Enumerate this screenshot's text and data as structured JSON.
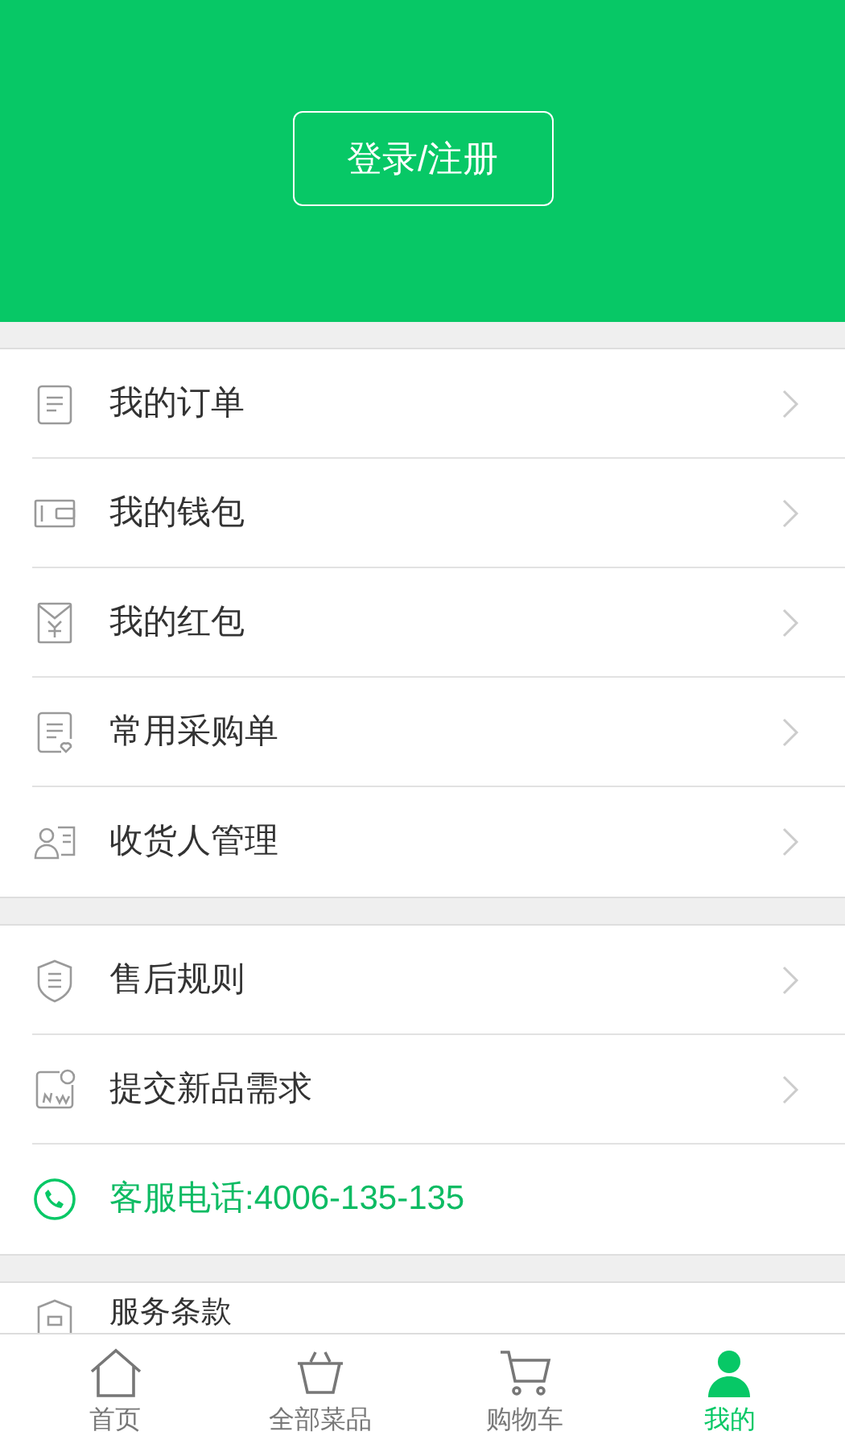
{
  "header": {
    "login_button": "登录/注册"
  },
  "sections": [
    {
      "items": [
        {
          "kind": "link",
          "label": "我的订单"
        },
        {
          "kind": "link",
          "label": "我的钱包"
        },
        {
          "kind": "link",
          "label": "我的红包"
        },
        {
          "kind": "link",
          "label": "常用采购单"
        },
        {
          "kind": "link",
          "label": "收货人管理"
        }
      ]
    },
    {
      "items": [
        {
          "kind": "link",
          "label": "售后规则"
        },
        {
          "kind": "link",
          "label": "提交新品需求"
        },
        {
          "kind": "phone",
          "label": "客服电话:4006-135-135"
        }
      ]
    },
    {
      "items": [
        {
          "kind": "partial",
          "label": "服务条款"
        }
      ]
    }
  ],
  "tab_bar": [
    {
      "label": "首页",
      "selected": false
    },
    {
      "label": "全部菜品",
      "selected": false
    },
    {
      "label": "购物车",
      "selected": false
    },
    {
      "label": "我的",
      "selected": true
    }
  ]
}
